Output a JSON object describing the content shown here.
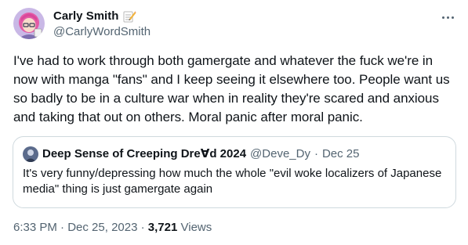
{
  "author": {
    "display_name": "Carly Smith",
    "name_emoji_icon": "memo-icon",
    "handle": "@CarlyWordSmith",
    "avatar": "avatar-illustration-pink-hair"
  },
  "more_icon": "more-horizontal-icon",
  "tweet": {
    "text": "I've had to work through both gamergate and whatever the fuck we're in now with manga \"fans\" and I keep seeing it elsewhere too. People want us so badly to be in a culture war when in reality they're scared and anxious and taking that out on others. Moral panic after moral panic."
  },
  "quote": {
    "display_name": "Deep Sense of Creeping Dre∀d 2024",
    "handle": "@Deve_Dy",
    "separator": "·",
    "date": "Dec 25",
    "text": "It's very funny/depressing how much the whole \"evil woke localizers of Japanese media\" thing is just gamergate again"
  },
  "meta": {
    "time": "6:33 PM",
    "sep1": "·",
    "date": "Dec 25, 2023",
    "sep2": "·",
    "views_count": "3,721",
    "views_label": "Views"
  },
  "colors": {
    "text": "#0f1419",
    "secondary": "#536471",
    "border": "#cfd9de",
    "avatar_bg": "#b9a8d6",
    "avatar_hair": "#e45aa6"
  }
}
